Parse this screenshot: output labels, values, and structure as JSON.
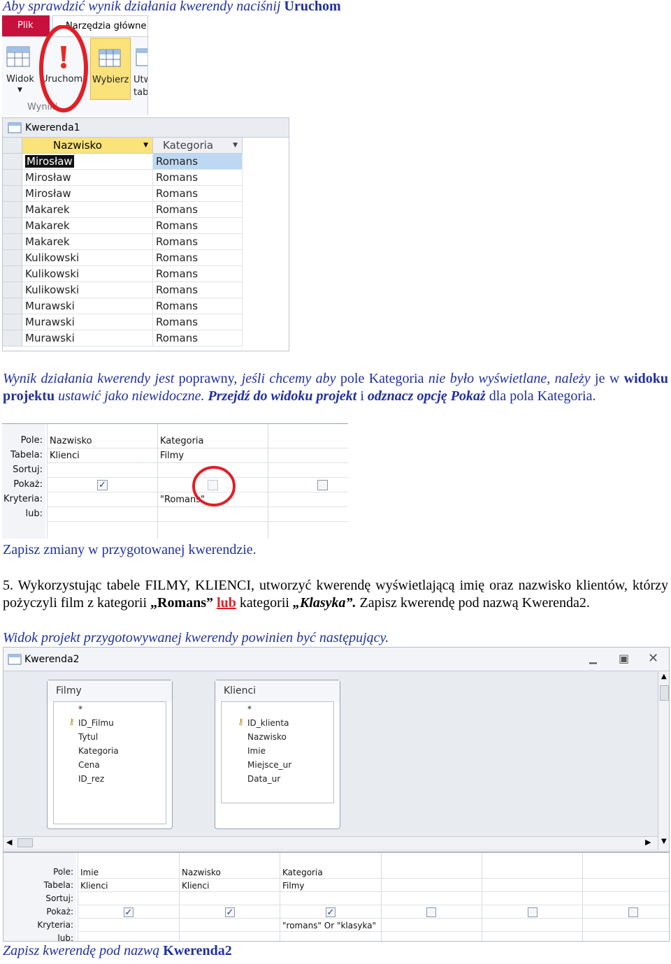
{
  "intro": {
    "text": "Aby sprawdzić wynik działania kwerendy naciśnij ",
    "bold": "Uruchom"
  },
  "ribbon": {
    "tab_file": "Plik",
    "tab_home": "Narzędzia główne",
    "btn_view": "Widok",
    "btn_run": "Uruchom",
    "btn_select": "Wybierz",
    "btn_make": "Utwórz tabelę",
    "group": "Wyniki"
  },
  "grid1": {
    "title": "Kwerenda1",
    "col1": "Nazwisko",
    "col2": "Kategoria",
    "rows": [
      [
        "Mirosław",
        "Romans"
      ],
      [
        "Mirosław",
        "Romans"
      ],
      [
        "Mirosław",
        "Romans"
      ],
      [
        "Makarek",
        "Romans"
      ],
      [
        "Makarek",
        "Romans"
      ],
      [
        "Makarek",
        "Romans"
      ],
      [
        "Kulikowski",
        "Romans"
      ],
      [
        "Kulikowski",
        "Romans"
      ],
      [
        "Kulikowski",
        "Romans"
      ],
      [
        "Murawski",
        "Romans"
      ],
      [
        "Murawski",
        "Romans"
      ],
      [
        "Murawski",
        "Romans"
      ]
    ]
  },
  "para1": {
    "a": "Wynik działania kwerendy jest ",
    "b": "poprawny, ",
    "c": "jeśli chcemy aby ",
    "d": "pole Kategoria ",
    "e": "nie było wyświetlane, należy ",
    "f": "je w ",
    "g": "widoku projektu ",
    "h": "ustawić jako niewidoczne. ",
    "i": "Przejdź do widoku projekt ",
    "j": "i ",
    "k": "odznacz opcję Pokaż ",
    "l": "dla pola Kategoria."
  },
  "design1": {
    "labels": [
      "Pole:",
      "Tabela:",
      "Sortuj:",
      "Pokaż:",
      "Kryteria:",
      "lub:"
    ],
    "c1_field": "Nazwisko",
    "c1_table": "Klienci",
    "c2_field": "Kategoria",
    "c2_table": "Filmy",
    "c2_crit": "\"Romans\""
  },
  "save1": "Zapisz zmiany w przygotowanej kwerendzie.",
  "task5": {
    "a": "5. Wykorzystując tabele FILMY, KLIENCI, utworzyć kwerendę wyświetlającą imię oraz nazwisko klientów, którzy pożyczyli film z kategorii ",
    "b": "„Romans”",
    "c": " ",
    "d": "lub",
    "e": " kategorii ",
    "f": "„Klasyka”.",
    "g": " Zapisz kwerendę pod nazwą Kwerenda2."
  },
  "widok": "Widok projekt przygotowywanej kwerendy powinien być następujący.",
  "win2": {
    "title": "Kwerenda2",
    "t1": {
      "name": "Filmy",
      "fields": [
        "*",
        "ID_Filmu",
        "Tytul",
        "Kategoria",
        "Cena",
        "ID_rez"
      ]
    },
    "t2": {
      "name": "Klienci",
      "fields": [
        "*",
        "ID_klienta",
        "Nazwisko",
        "Imie",
        "Miejsce_ur",
        "Data_ur"
      ]
    },
    "labels": [
      "Pole:",
      "Tabela:",
      "Sortuj:",
      "Pokaż:",
      "Kryteria:",
      "lub:"
    ],
    "cols": [
      {
        "field": "Imie",
        "table": "Klienci"
      },
      {
        "field": "Nazwisko",
        "table": "Klienci"
      },
      {
        "field": "Kategoria",
        "table": "Filmy",
        "crit": "\"romans\" Or \"klasyka\""
      }
    ]
  },
  "final": {
    "text": "Zapisz kwerendę pod nazwą ",
    "bold": "Kwerenda2"
  },
  "colors": {
    "blue": "#1f2fa3",
    "red": "#e01f26",
    "plik": "#c8103d"
  }
}
